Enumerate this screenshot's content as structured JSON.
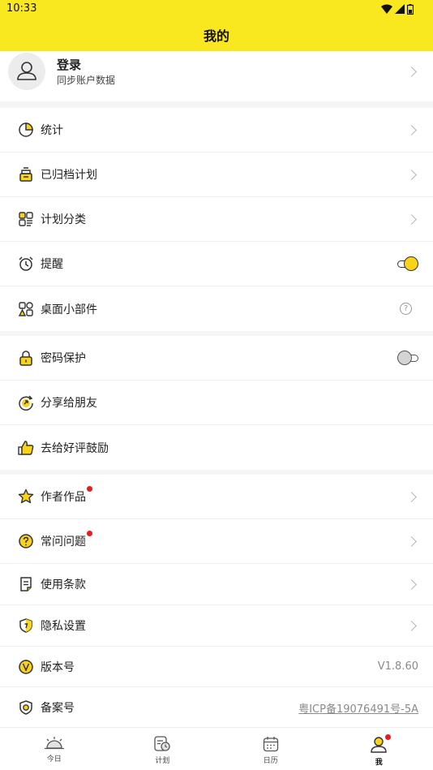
{
  "status_bar": {
    "time": "10:33"
  },
  "header": {
    "title": "我的"
  },
  "profile": {
    "name": "登录",
    "subtitle": "同步账户数据"
  },
  "section1": {
    "items": [
      {
        "label": "统计"
      },
      {
        "label": "已归档计划"
      },
      {
        "label": "计划分类"
      },
      {
        "label": "提醒",
        "toggle": true
      },
      {
        "label": "桌面小部件",
        "help": "?"
      }
    ]
  },
  "section2": {
    "items": [
      {
        "label": "密码保护",
        "toggle": false
      },
      {
        "label": "分享给朋友"
      },
      {
        "label": "去给好评鼓励"
      }
    ]
  },
  "section3": {
    "items": [
      {
        "label": "作者作品",
        "badge": true
      },
      {
        "label": "常问问题",
        "badge": true
      },
      {
        "label": "使用条款"
      },
      {
        "label": "隐私设置"
      },
      {
        "label": "版本号",
        "value": "V1.8.60"
      },
      {
        "label": "备案号",
        "value": "粤ICP备19076491号-5A"
      }
    ]
  },
  "tabbar": {
    "tabs": [
      {
        "label": "今日"
      },
      {
        "label": "计划"
      },
      {
        "label": "日历"
      },
      {
        "label": "我",
        "active": true
      }
    ]
  },
  "colors": {
    "brand_yellow": "#f9e71f",
    "badge_red": "#f01818"
  }
}
